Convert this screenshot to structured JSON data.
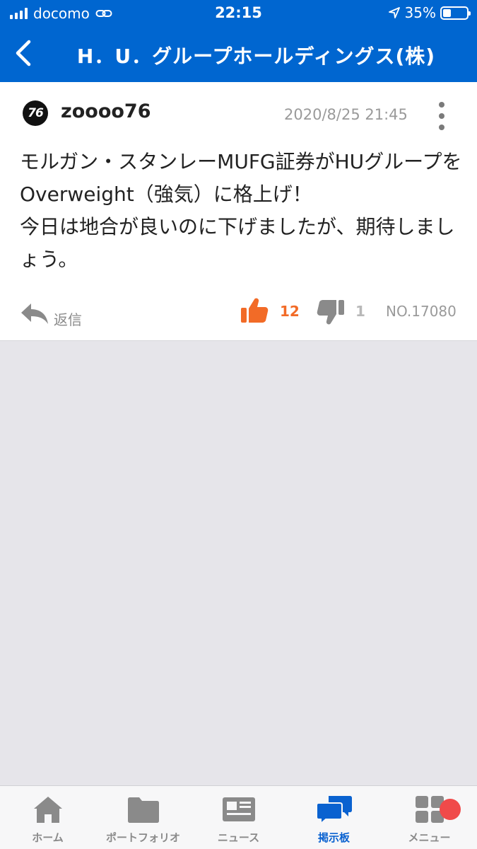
{
  "status": {
    "carrier": "docomo",
    "time": "22:15",
    "battery": "35%",
    "battery_level": 0.35
  },
  "nav": {
    "title": "H．U．グループホールディングス(株)"
  },
  "post": {
    "avatar_text": "76",
    "username": "zoooo76",
    "timestamp": "2020/8/25 21:45",
    "body": "モルガン・スタンレーMUFG証券がHUグループをOverweight（強気）に格上げ！\n今日は地合が良いのに下げましたが、期待しましょう。",
    "reply_label": "返信",
    "likes": "12",
    "dislikes": "1",
    "number": "NO.17080"
  },
  "tabs": [
    {
      "label": "ホーム"
    },
    {
      "label": "ポートフォリオ"
    },
    {
      "label": "ニュース"
    },
    {
      "label": "掲示板"
    },
    {
      "label": "メニュー"
    }
  ],
  "colors": {
    "brand": "#0066d0",
    "like": "#f26b27",
    "badge": "#f04a4a"
  }
}
